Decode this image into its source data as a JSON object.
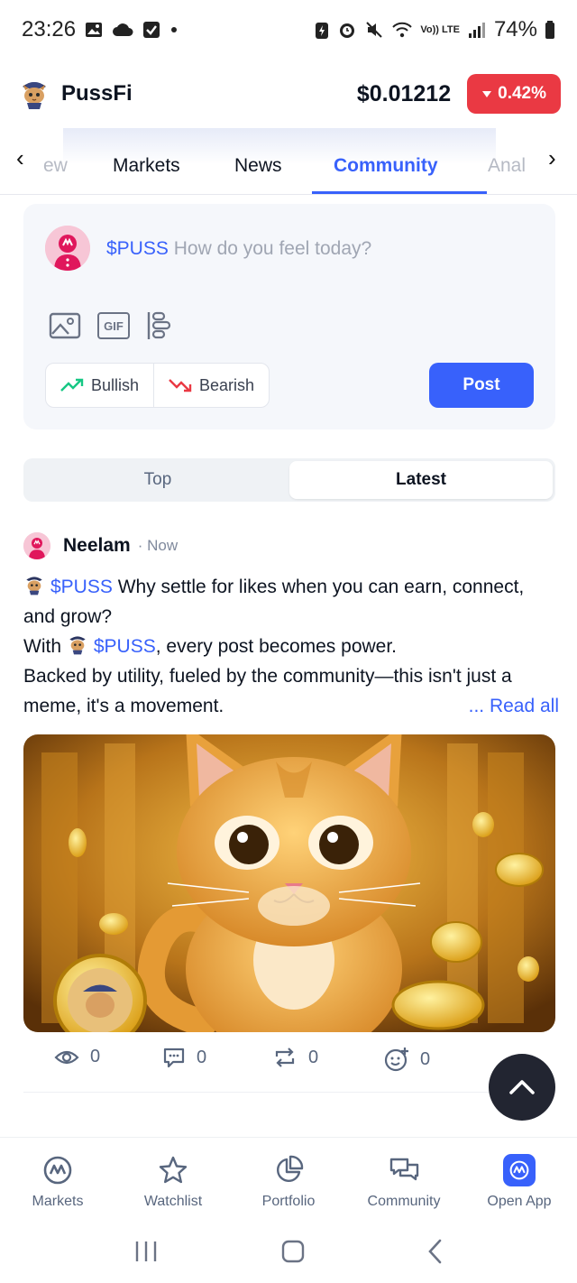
{
  "status_bar": {
    "time": "23:26",
    "battery": "74%",
    "network": "Vo)) LTE"
  },
  "header": {
    "coin_name": "PussFi",
    "price": "$0.01212",
    "change": "0.42%",
    "change_color": "#ea3943"
  },
  "tabs": {
    "items": [
      "ew",
      "Markets",
      "News",
      "Community",
      "Anal"
    ],
    "active": "Community",
    "prev_arrow": "‹",
    "next_arrow": "›"
  },
  "composer": {
    "ticker": "$PUSS",
    "placeholder": "How do you feel today?",
    "tools": [
      "image-icon",
      "gif-icon",
      "poll-icon"
    ],
    "gif_label": "GIF",
    "bullish_label": "Bullish",
    "bearish_label": "Bearish",
    "post_label": "Post"
  },
  "feed_toggle": {
    "top_label": "Top",
    "latest_label": "Latest",
    "active": "Latest"
  },
  "post": {
    "author": "Neelam",
    "time": "· Now",
    "ticker1": "$PUSS",
    "line1": " Why settle for likes when you can earn, connect, and grow?",
    "with": "With ",
    "ticker2": "$PUSS",
    "line2": ", every post becomes power.",
    "line3": "Backed by utility, fueled by the community—this isn't just a meme, it's a movement.",
    "read_all": "... Read all",
    "views": "0",
    "comments": "0",
    "reposts": "0",
    "reactions": "0"
  },
  "bottom_nav": {
    "items": [
      {
        "label": "Markets",
        "icon": "markets-icon"
      },
      {
        "label": "Watchlist",
        "icon": "star-icon"
      },
      {
        "label": "Portfolio",
        "icon": "pie-chart-icon"
      },
      {
        "label": "Community",
        "icon": "chat-icon"
      },
      {
        "label": "Open App",
        "icon": "open-app-icon"
      }
    ]
  },
  "colors": {
    "accent": "#3861fb",
    "bullish": "#16c784",
    "bearish": "#ea3943"
  }
}
